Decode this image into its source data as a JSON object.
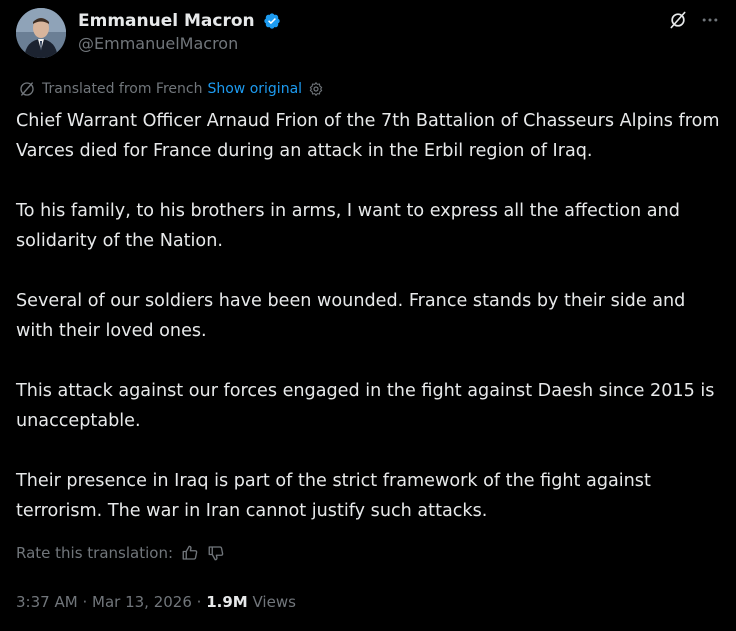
{
  "author": {
    "display_name": "Emmanuel Macron",
    "handle": "@EmmanuelMacron",
    "verified_badge_color": "#1d9bf0"
  },
  "header_icons": [
    "grok-icon",
    "more-icon"
  ],
  "translation": {
    "label": "Translated from French",
    "show_original": "Show original"
  },
  "tweet": {
    "paragraphs": [
      "Chief Warrant Officer Arnaud Frion of the 7th Battalion of Chasseurs Alpins from Varces died for France during an attack in the Erbil region of Iraq.",
      "To his family, to his brothers in arms, I want to express all the affection and solidarity of the Nation.",
      "Several of our soldiers have been wounded. France stands by their side and with their loved ones.",
      "This attack against our forces engaged in the fight against Daesh since 2015 is unacceptable.",
      "Their presence in Iraq is part of the strict framework of the fight against terrorism. The war in Iran cannot justify such attacks."
    ]
  },
  "rate": {
    "label": "Rate this translation:"
  },
  "meta": {
    "time": "3:37 AM",
    "separator": "·",
    "date": "Mar 13, 2026",
    "views_count": "1.9M",
    "views_label": "Views"
  },
  "colors": {
    "background": "#000000",
    "text_primary": "#e7e9ea",
    "text_secondary": "#71767b",
    "link": "#1d9bf0"
  }
}
